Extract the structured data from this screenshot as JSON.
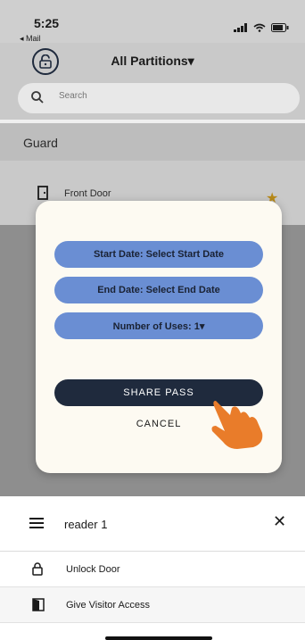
{
  "status_bar": {
    "time": "5:25",
    "back_label": "◂ Mail"
  },
  "nav": {
    "title": "All Partitions▾"
  },
  "search": {
    "placeholder": "Search"
  },
  "section": {
    "title": "Guard"
  },
  "door": {
    "label": "Front Door",
    "favorite_icon": "star-icon"
  },
  "modal": {
    "start_date_label": "Start Date: Select Start Date",
    "end_date_label": "End Date: Select End Date",
    "uses_label": "Number of Uses: 1▾",
    "share_label": "SHARE PASS",
    "cancel_label": "CANCEL"
  },
  "sheet": {
    "reader_name": "reader 1",
    "close_label": "✕",
    "items": [
      {
        "label": "Unlock Door",
        "icon": "lock-icon"
      },
      {
        "label": "Give Visitor Access",
        "icon": "visitor-door-icon"
      }
    ]
  },
  "colors": {
    "pill_blue": "#6a8ed3",
    "share_navy": "#1f2a3d",
    "modal_bg": "#fdfaf2",
    "star_gold": "#b88a1a",
    "hand_orange": "#e97c2a"
  }
}
